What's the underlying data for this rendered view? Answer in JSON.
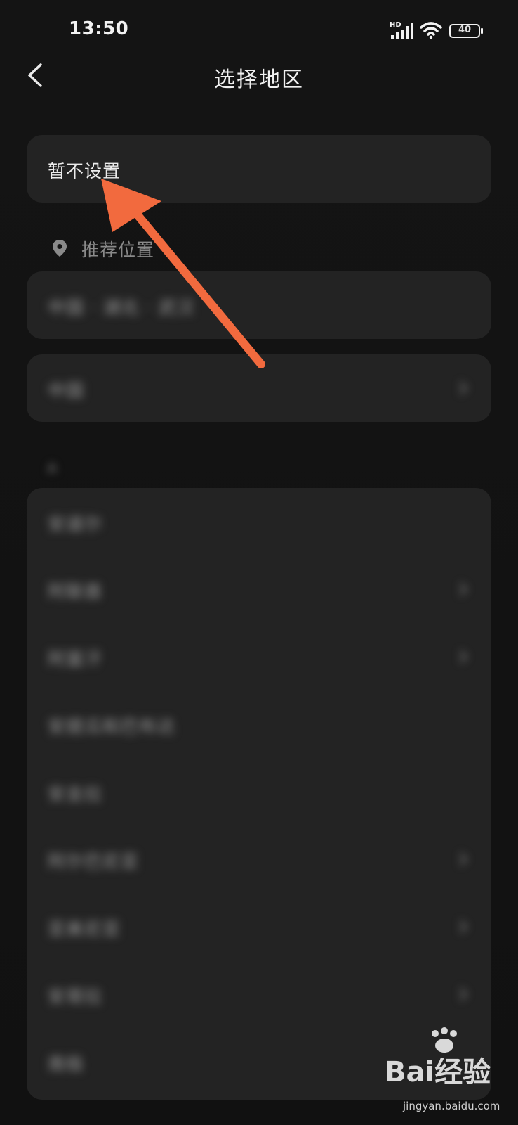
{
  "status": {
    "time": "13:50",
    "network_label": "HD",
    "battery": "40"
  },
  "header": {
    "title": "选择地区"
  },
  "not_set": {
    "label": "暂不设置"
  },
  "recommended": {
    "section_label": "推荐位置",
    "current_location": "中国 · 湖北 · 武汉",
    "country": "中国"
  },
  "index_letter": "A",
  "countries": [
    {
      "label": "安道尔"
    },
    {
      "label": "阿联酋"
    },
    {
      "label": "阿富汗"
    },
    {
      "label": "安提瓜和巴布达"
    },
    {
      "label": "安圭拉"
    },
    {
      "label": "阿尔巴尼亚"
    },
    {
      "label": "亚美尼亚"
    },
    {
      "label": "安哥拉"
    },
    {
      "label": "南极"
    }
  ],
  "watermark": {
    "brand": "Bai",
    "brand2": "经验",
    "url": "jingyan.baidu.com"
  },
  "colors": {
    "annotation_arrow": "#f26a3e",
    "background": "#121212",
    "card": "#232323"
  }
}
